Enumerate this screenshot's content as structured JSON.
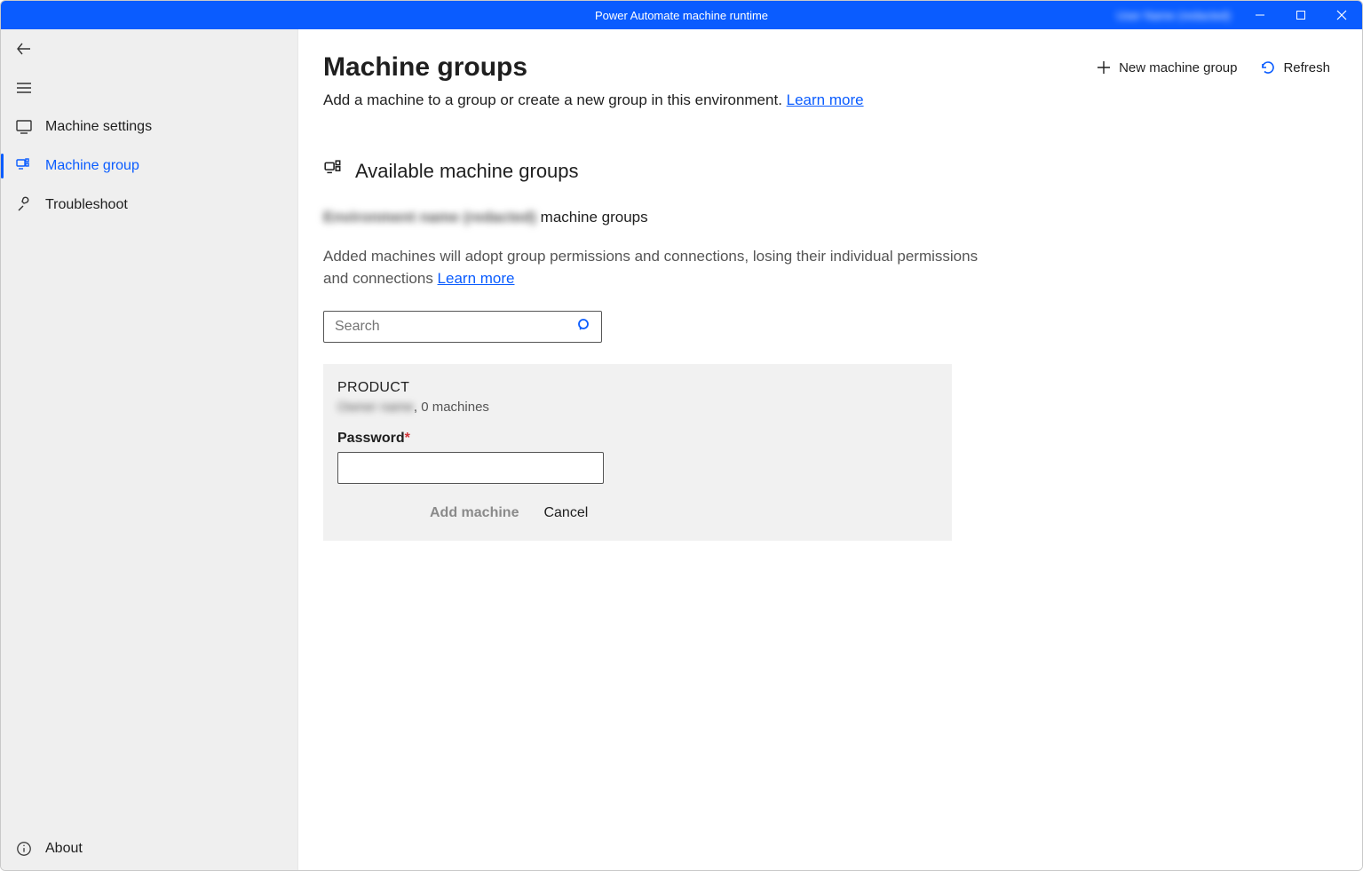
{
  "window": {
    "title": "Power Automate machine runtime",
    "user": "User Name (redacted)"
  },
  "sidebar": {
    "items": [
      {
        "label": "Machine settings"
      },
      {
        "label": "Machine group"
      },
      {
        "label": "Troubleshoot"
      }
    ],
    "about": "About"
  },
  "header": {
    "title": "Machine groups",
    "new_group": "New machine group",
    "refresh": "Refresh"
  },
  "intro": {
    "text": "Add a machine to a group or create a new group in this environment. ",
    "learn_more": "Learn more"
  },
  "section": {
    "title": "Available machine groups"
  },
  "env": {
    "name_redacted": "Environment name (redacted)",
    "suffix": " machine groups"
  },
  "description": {
    "text": "Added machines will adopt group permissions and connections, losing their individual permissions and connections ",
    "learn_more": "Learn more"
  },
  "search": {
    "placeholder": "Search"
  },
  "card": {
    "title": "PRODUCT",
    "owner_redacted": "Owner name",
    "machines_suffix": ", 0 machines",
    "password_label": "Password",
    "required_mark": "*",
    "add_label": "Add machine",
    "cancel_label": "Cancel"
  }
}
